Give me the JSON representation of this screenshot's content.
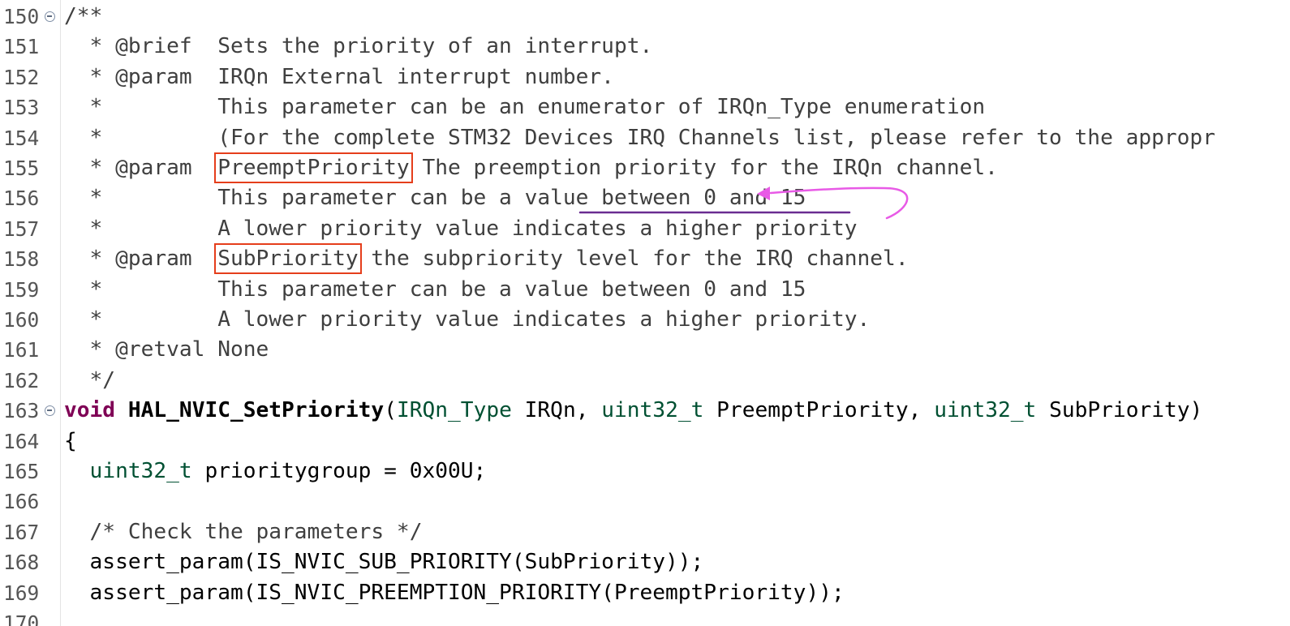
{
  "editor": {
    "lines": [
      {
        "num": "150",
        "fold": true,
        "segs": [
          {
            "t": "/**",
            "c": "cm"
          }
        ]
      },
      {
        "num": "151",
        "segs": [
          {
            "t": "  * @brief  Sets the priority of an interrupt.",
            "c": "cm"
          }
        ]
      },
      {
        "num": "152",
        "segs": [
          {
            "t": "  * @param  IRQn External interrupt number.",
            "c": "cm"
          }
        ]
      },
      {
        "num": "153",
        "segs": [
          {
            "t": "  *         This parameter can be an enumerator of IRQn_Type enumeration",
            "c": "cm"
          }
        ]
      },
      {
        "num": "154",
        "segs": [
          {
            "t": "  *         (For the complete STM32 Devices IRQ Channels list, please refer to the appropr",
            "c": "cm"
          }
        ]
      },
      {
        "num": "155",
        "segs": [
          {
            "t": "  * @param  ",
            "c": "cm"
          },
          {
            "t": "PreemptPriority",
            "c": "cm",
            "hl": true,
            "name": "highlight-preemptpriority"
          },
          {
            "t": " The preemption priority for the IRQn channel.",
            "c": "cm"
          }
        ]
      },
      {
        "num": "156",
        "segs": [
          {
            "t": "  *         This parameter can be a value between 0 and 15",
            "c": "cm"
          }
        ]
      },
      {
        "num": "157",
        "segs": [
          {
            "t": "  *         A lower priority value indicates a higher priority",
            "c": "cm"
          }
        ]
      },
      {
        "num": "158",
        "segs": [
          {
            "t": "  * @param  ",
            "c": "cm"
          },
          {
            "t": "SubPriority",
            "c": "cm",
            "hl": true,
            "name": "highlight-subpriority"
          },
          {
            "t": " the subpriority level for the IRQ channel.",
            "c": "cm"
          }
        ]
      },
      {
        "num": "159",
        "segs": [
          {
            "t": "  *         This parameter can be a value between 0 and 15",
            "c": "cm"
          }
        ]
      },
      {
        "num": "160",
        "segs": [
          {
            "t": "  *         A lower priority value indicates a higher priority.",
            "c": "cm"
          }
        ]
      },
      {
        "num": "161",
        "segs": [
          {
            "t": "  * @retval None",
            "c": "cm"
          }
        ]
      },
      {
        "num": "162",
        "segs": [
          {
            "t": "  */",
            "c": "cm"
          }
        ]
      },
      {
        "num": "163",
        "fold": true,
        "segs": [
          {
            "t": "void",
            "c": "kw"
          },
          {
            "t": " "
          },
          {
            "t": "HAL_NVIC_SetPriority",
            "c": "fn"
          },
          {
            "t": "("
          },
          {
            "t": "IRQn_Type",
            "c": "ty"
          },
          {
            "t": " IRQn, "
          },
          {
            "t": "uint32_t",
            "c": "ty"
          },
          {
            "t": " PreemptPriority, "
          },
          {
            "t": "uint32_t",
            "c": "ty"
          },
          {
            "t": " SubPriority)"
          }
        ]
      },
      {
        "num": "164",
        "segs": [
          {
            "t": "{"
          }
        ]
      },
      {
        "num": "165",
        "segs": [
          {
            "t": "  "
          },
          {
            "t": "uint32_t",
            "c": "ty"
          },
          {
            "t": " prioritygroup = 0x00U;"
          }
        ]
      },
      {
        "num": "166",
        "segs": [
          {
            "t": ""
          }
        ]
      },
      {
        "num": "167",
        "segs": [
          {
            "t": "  /* Check the parameters */",
            "c": "cm"
          }
        ]
      },
      {
        "num": "168",
        "segs": [
          {
            "t": "  assert_param(IS_NVIC_SUB_PRIORITY(SubPriority));"
          }
        ]
      },
      {
        "num": "169",
        "segs": [
          {
            "t": "  assert_param(IS_NVIC_PREEMPTION_PRIORITY(PreemptPriority));"
          }
        ]
      },
      {
        "num": "170",
        "segs": [
          {
            "t": ""
          }
        ]
      }
    ]
  },
  "annotations": {
    "box_color": "#e53e1b",
    "underline_color": "#6a2c91",
    "arrow_color": "#e85ae6"
  }
}
